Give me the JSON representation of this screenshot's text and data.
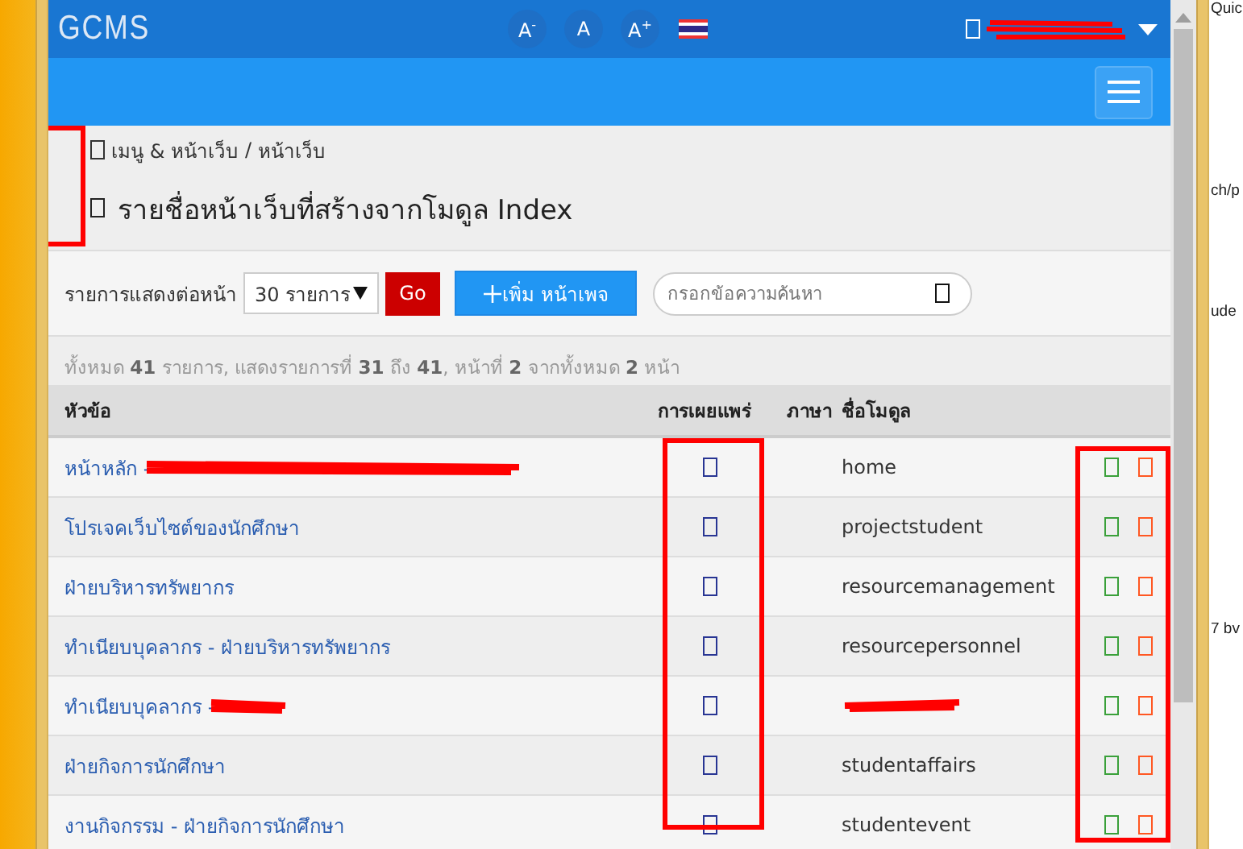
{
  "header": {
    "logo": "GCMS",
    "font_buttons": [
      "A$^{-}$",
      "A",
      "A$^{+}$"
    ],
    "user": {
      "redacted": true
    }
  },
  "breadcrumb": [
    "เมนู & หน้าเว็บ",
    "/",
    "หน้าเว็บ"
  ],
  "title": "รายชื่อหน้าเว็บที่สร้างจากโมดูล Index",
  "toolbar": {
    "per_page_label": "รายการแสดงต่อหน้า",
    "per_page_value": "30 รายการ",
    "go_button": "Go",
    "add_button": "เพิ่ม หน้าเพจ",
    "search": {
      "placeholder": "กรอกข้อความค้นหา"
    }
  },
  "summary": "ทั้งหมด **41** รายการ, แสดงรายการที่ **31** ถึง **41**, หน้าที่ **2** จากทั้งหมด **2** หน้า",
  "table": {
    "columns": [
      "หัวข้อ",
      "การเผยแพร่",
      "ภาษา",
      "ชื่อโมดูล"
    ],
    "rows": [
      {
        "title": "หน้าหลัก -",
        "title_redacted": true,
        "module": "home"
      },
      {
        "title": "โปรเจคเว็บไซต์ของนักศึกษา",
        "title_redacted": false,
        "module": "projectstudent"
      },
      {
        "title": "ฝ่ายบริหารทรัพยากร",
        "title_redacted": false,
        "module": "resourcemanagement"
      },
      {
        "title": "ทำเนียบบุคลากร - ฝ่ายบริหารทรัพยากร",
        "title_redacted": false,
        "module": "resourcepersonnel"
      },
      {
        "title": "ทำเนียบบุคลากร -",
        "title_redacted": true,
        "module_redacted": true
      },
      {
        "title": "ฝ่ายกิจการนักศึกษา",
        "title_redacted": false,
        "module": "studentaffairs"
      },
      {
        "title": "งานกิจกรรม - ฝ่ายกิจการนักศึกษา",
        "title_redacted": false,
        "module": "studentevent"
      }
    ]
  },
  "background_window": {
    "texts": [
      "Quic",
      "ch/p",
      "ude",
      "7 bv"
    ]
  }
}
